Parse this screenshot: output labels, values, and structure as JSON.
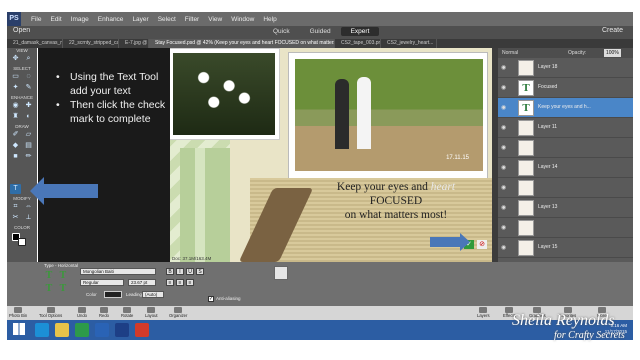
{
  "app": {
    "logo": "PS",
    "menu": [
      "File",
      "Edit",
      "Image",
      "Enhance",
      "Layer",
      "Select",
      "Filter",
      "View",
      "Window",
      "Help"
    ],
    "open_label": "Open",
    "create_label": "Create",
    "modes": [
      "Quick",
      "Guided",
      "Expert"
    ],
    "active_mode": "Expert"
  },
  "doc_tabs": [
    "21_damask_canvas_mext.jpg",
    "22_scrnty_stripped_canvas.jpg",
    "E-7.jpg @ 3...",
    "Stay Focused.psd @ 42% (Keep your eyes and heart FOCUSED on what matters most!, RGB/8) *",
    "CS2_tape_003.png",
    "CS2_jewelry_heart..."
  ],
  "toolbox": {
    "labels": [
      "VIEW",
      "SELECT",
      "ENHANCE",
      "DRAW",
      "MODIFY",
      "COLOR"
    ]
  },
  "instructions": [
    "Using the Text Tool add your text",
    "Then click the check mark to complete"
  ],
  "canvas": {
    "quote_line1": "Keep your eyes and",
    "quote_faded": "heart",
    "quote_line2": "FOCUSED",
    "quote_line3": "on what matters most!",
    "date_stamp": "17.11.15",
    "commit_glyph": "✓",
    "cancel_glyph": "⊘",
    "status": "Doc: 37.1M/163.4M"
  },
  "layers_panel": {
    "mode": "Normal",
    "opacity_label": "Opacity:",
    "opacity": "100%",
    "layers": [
      {
        "name": "Layer 18",
        "type": "image",
        "selected": false
      },
      {
        "name": "Focused",
        "type": "text",
        "selected": false
      },
      {
        "name": "Keep your eyes and h...",
        "type": "text",
        "selected": true
      },
      {
        "name": "Layer 11",
        "type": "image",
        "selected": false
      },
      {
        "name": "",
        "type": "image",
        "selected": false
      },
      {
        "name": "Layer 14",
        "type": "image",
        "selected": false
      },
      {
        "name": "",
        "type": "image",
        "selected": false
      },
      {
        "name": "Layer 13",
        "type": "image",
        "selected": false
      },
      {
        "name": "",
        "type": "image",
        "selected": false
      },
      {
        "name": "Layer 15",
        "type": "image",
        "selected": false
      }
    ]
  },
  "tool_options": {
    "type_label": "Type - Horizontal",
    "font_family": "Mongolian Baiti",
    "font_style": "Regular",
    "font_size": "23.67 pt",
    "bold": "B",
    "italic": "I",
    "underline": "U",
    "strike": "S",
    "color_label": "Color",
    "leading_label": "Leading",
    "leading_value": "(Auto)",
    "antialias_label": "Anti-aliasing"
  },
  "panel_bar": {
    "left": [
      "Photo Bin",
      "Tool Options",
      "Undo",
      "Redo",
      "Rotate",
      "Layout",
      "Organizer"
    ],
    "right": [
      "Layers",
      "Effects",
      "Graphics",
      "Favorites",
      "More"
    ]
  },
  "taskbar": {
    "time": "9:16 AM",
    "date": "11/17/2015"
  },
  "watermark": {
    "line1": "Sheila Reynolds",
    "line2": "for Crafty Secrets"
  },
  "colors": {
    "arrow_blue": "#4a77b8",
    "selected_layer": "#4a86c8",
    "taskbar": "#2c5da3",
    "commit_green": "#2f9a3a"
  }
}
